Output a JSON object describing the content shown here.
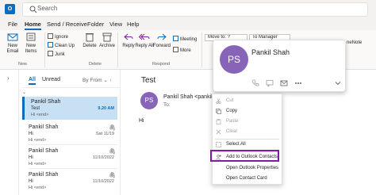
{
  "titlebar": {
    "app_badge": "O",
    "search_placeholder": "Search"
  },
  "menu": {
    "tabs": [
      "File",
      "Home",
      "Send / Receive",
      "Folder",
      "View",
      "Help"
    ],
    "active": "Home"
  },
  "ribbon": {
    "new_email": "New Email",
    "new_items": "New Items",
    "new_items_caret": "⌄",
    "group_new": "New",
    "ignore": "Ignore",
    "clean_up": "Clean Up",
    "junk": "Junk",
    "delete": "Delete",
    "archive": "Archive",
    "group_delete": "Delete",
    "reply": "Reply",
    "reply_all": "Reply All",
    "forward": "Forward",
    "meeting": "Meeting",
    "more": "More",
    "group_respond": "Respond",
    "move_to": "Move to: ?",
    "to_manager": "To Manager",
    "onenote": "neNote"
  },
  "list": {
    "filter_all": "All",
    "filter_unread": "Unread",
    "sort": "By From",
    "sort_caret": "⌄",
    "sort_arrow": "↑",
    "items": [
      {
        "sender": "Pankil Shah",
        "subject": "Test",
        "preview": "Hi <end>",
        "date": "9.20 AM",
        "attachment": false
      },
      {
        "sender": "Pankil Shah",
        "subject": "Hi",
        "preview": "Hi <end>",
        "date": "Sat 11/19",
        "attachment": true
      },
      {
        "sender": "Pankil Shah",
        "subject": "Hi",
        "preview": "Hi <end>",
        "date": "11/10/2022",
        "attachment": true
      },
      {
        "sender": "Pankil Shah",
        "subject": "Hi",
        "preview": "Hi <end>",
        "date": "11/10/2022",
        "attachment": true
      }
    ]
  },
  "reading": {
    "subject": "Test",
    "avatar_initials": "PS",
    "sender": "Pankil Shah <pankil.sh",
    "to": "To:",
    "body": "Hi"
  },
  "contact_card": {
    "initials": "PS",
    "name": "Pankil Shah"
  },
  "context_menu": {
    "items": [
      {
        "label": "Cut",
        "disabled": true
      },
      {
        "label": "Copy",
        "disabled": false
      },
      {
        "label": "Paste",
        "disabled": true
      },
      {
        "label": "Clear",
        "disabled": true
      },
      {
        "label": "Select All",
        "disabled": false
      },
      {
        "label": "Add to Outlook Contacts",
        "disabled": false,
        "highlighted": true
      },
      {
        "label": "Open Outlook Properties",
        "disabled": false
      },
      {
        "label": "Open Contact Card",
        "disabled": false
      }
    ]
  },
  "colors": {
    "accent": "#0f6cbd",
    "avatar": "#8764b8",
    "highlight_box": "#7a1fa2",
    "selected_row": "#c7e0f4"
  }
}
